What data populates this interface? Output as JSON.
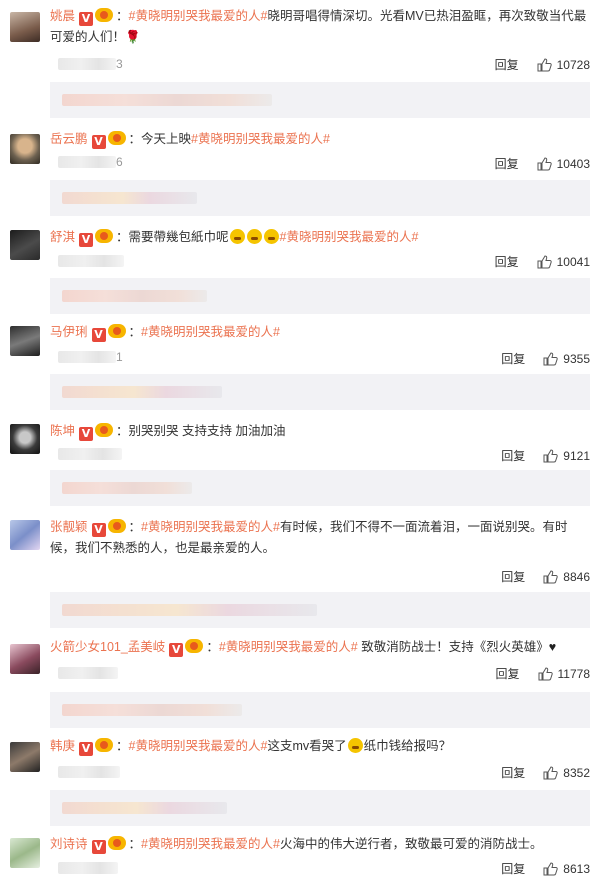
{
  "reply_label": "回复",
  "comments": [
    {
      "username": "姚晨",
      "topic": "#黄晓明别哭我最爱的人#",
      "text": "晓明哥唱得情深切。光看MV已热泪盈眶，再次致敬当代最可爱的人们！",
      "trail": "🌹",
      "likes": "10728",
      "blur_digit": "3"
    },
    {
      "username": "岳云鹏",
      "text": "今天上映",
      "topic": "#黄晓明别哭我最爱的人#",
      "likes": "10403",
      "blur_digit": "6"
    },
    {
      "username": "舒淇",
      "text": "需要帶幾包紙巾呢",
      "topic": "#黄晓明别哭我最爱的人#",
      "likes": "10041"
    },
    {
      "username": "马伊琍",
      "topic": "#黄晓明别哭我最爱的人#",
      "likes": "9355",
      "blur_digit": "1"
    },
    {
      "username": "陈坤",
      "text": "别哭别哭 支持支持 加油加油",
      "likes": "9121"
    },
    {
      "username": "张靓颖",
      "topic": "#黄晓明别哭我最爱的人#",
      "text": "有时候，我们不得不一面流着泪，一面说别哭。有时候，我们不熟悉的人，也是最亲爱的人。",
      "likes": "8846"
    },
    {
      "username": "火箭少女101_孟美岐",
      "topic": "#黄晓明别哭我最爱的人#",
      "text": "致敬消防战士！支持《烈火英雄》",
      "trail": "♥",
      "likes": "11778"
    },
    {
      "username": "韩庚",
      "topic": "#黄晓明别哭我最爱的人#",
      "text_a": "这支mv看哭了",
      "text_b": "纸巾钱给报吗？",
      "likes": "8352"
    },
    {
      "username": "刘诗诗",
      "topic": "#黄晓明别哭我最爱的人#",
      "text": "火海中的伟大逆行者，致敬最可爱的消防战士。",
      "likes": "8613"
    }
  ],
  "colors": {
    "accent": "#eb7350",
    "reply_bg": "#f2f2f5",
    "verified": "#e7483a"
  },
  "icons": {
    "like": "thumbs-up-icon",
    "verified": "verified-v-icon",
    "medal": "member-medal-icon"
  }
}
